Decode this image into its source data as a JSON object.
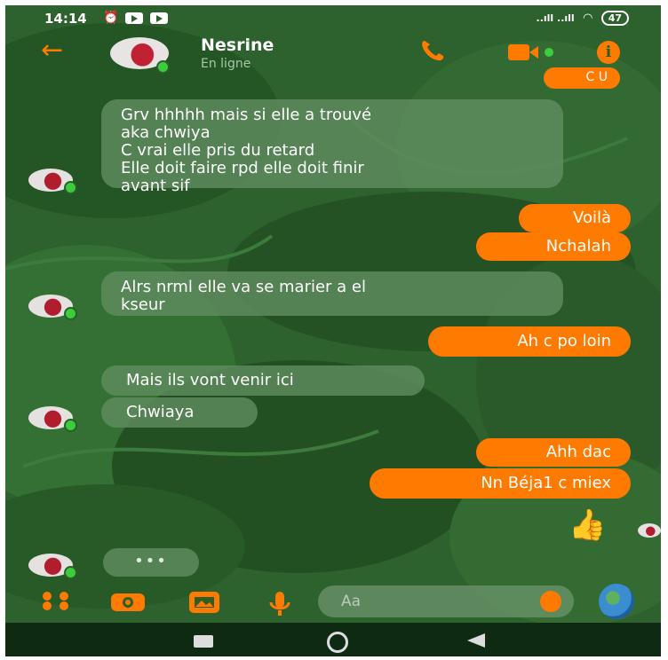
{
  "status_bar": {
    "time": "14:14",
    "battery": "47",
    "signal": "..ıll ..ıll"
  },
  "header": {
    "contact_name": "Nesrine",
    "presence": "En ligne",
    "info_glyph": "i"
  },
  "messages": {
    "partial_top": "C U",
    "m1": "Grv hhhhh mais si elle a trouvé\naka chwiya\nC vrai elle pris du retard\nElle doit faire rpd elle doit finir\navant sif",
    "m2": "Voilà",
    "m3": "Nchalah",
    "m4": "Alrs nrml elle va se marier a el\nkseur",
    "m5": "Ah c po loin",
    "m6": "Mais ils vont venir ici",
    "m7": "Chwiaya",
    "m8": "Ahh dac",
    "m9": "Nn Béja1 c miex",
    "thumb": "👍",
    "typing": "•••"
  },
  "composer": {
    "placeholder": "Aa"
  },
  "colors": {
    "accent": "#ff7a00",
    "background": "#2a5f2a",
    "incoming_bubble": "#5f8c5f",
    "online": "#3ccc3c"
  },
  "icons": [
    "arrow-left-icon",
    "phone-icon",
    "video-icon",
    "info-icon",
    "apps-icon",
    "camera-icon",
    "gallery-icon",
    "microphone-icon",
    "emoji-icon",
    "globe-icon"
  ]
}
